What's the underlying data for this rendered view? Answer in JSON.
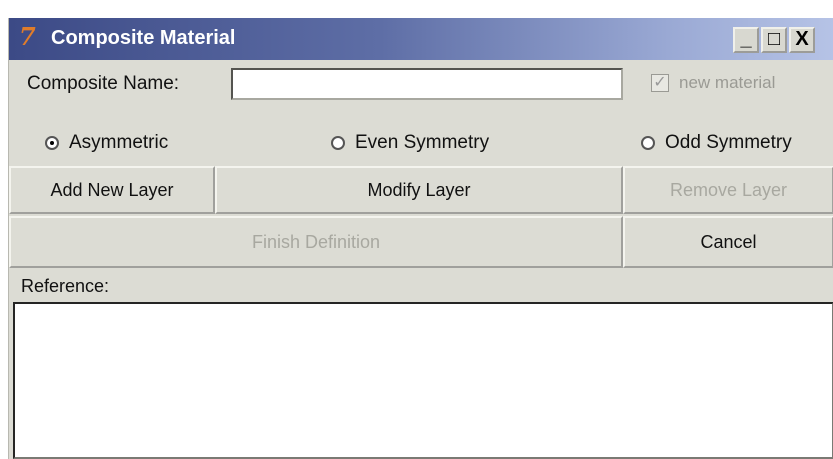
{
  "window": {
    "title": "Composite Material",
    "icon": "app-logo-icon",
    "controls": {
      "minimize": "_",
      "maximize": "□",
      "close": "X"
    }
  },
  "form": {
    "name_label": "Composite Name:",
    "name_value": "",
    "new_material_label": "new material",
    "new_material_checked": true
  },
  "symmetry": {
    "options": [
      {
        "label": "Asymmetric",
        "selected": true
      },
      {
        "label": "Even Symmetry",
        "selected": false
      },
      {
        "label": "Odd Symmetry",
        "selected": false
      }
    ]
  },
  "buttons": {
    "add_layer": "Add New Layer",
    "modify_layer": "Modify Layer",
    "remove_layer": "Remove Layer",
    "finish": "Finish Definition",
    "cancel": "Cancel"
  },
  "reference": {
    "label": "Reference:",
    "value": ""
  }
}
